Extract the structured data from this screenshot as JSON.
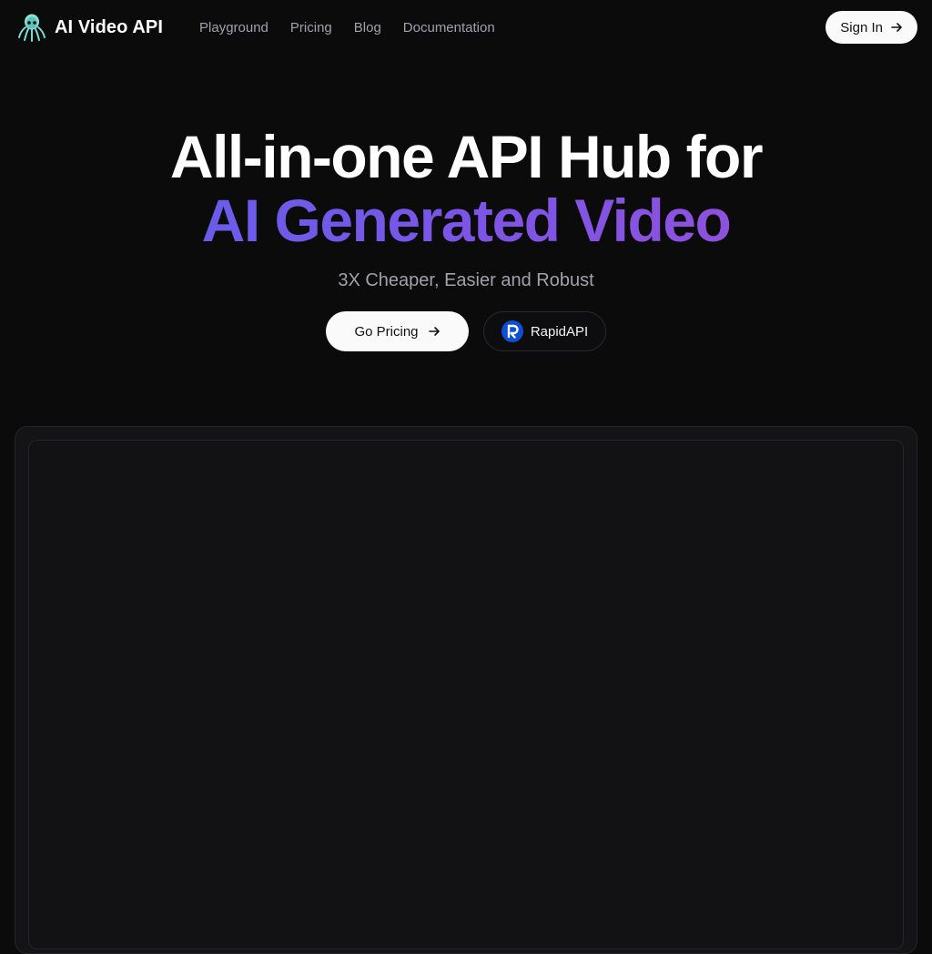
{
  "nav": {
    "brand": "AI Video API",
    "links": [
      "Playground",
      "Pricing",
      "Blog",
      "Documentation"
    ],
    "signin_label": "Sign In"
  },
  "hero": {
    "line1": "All-in-one API Hub for",
    "line2": "AI Generated Video",
    "subtitle": "3X Cheaper, Easier and Robust",
    "primary_label": "Go Pricing",
    "secondary_label": "RapidAPI"
  },
  "colors": {
    "background": "#0b0b0c",
    "gradient_start": "#5b62ec",
    "gradient_end": "#9b4fd6",
    "rapidapi_blue": "#0e4fd6",
    "logo_teal": "#7fd8d2"
  },
  "icons": {
    "brand": "octopus-icon",
    "signin": "arrow-right-icon",
    "pricing": "arrow-right-icon",
    "rapidapi": "rapidapi-logo-icon"
  }
}
